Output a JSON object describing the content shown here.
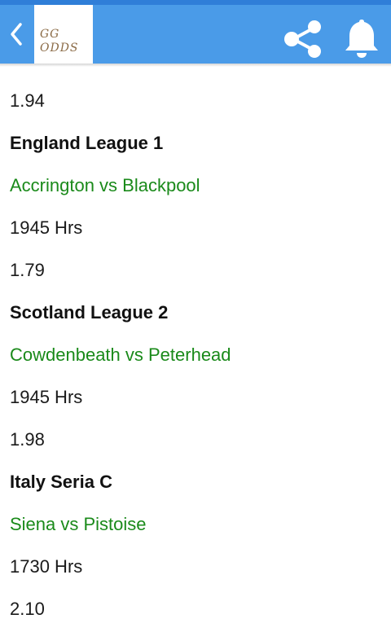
{
  "app_bar": {
    "logo_line1": "GG",
    "logo_line2": "ODDS",
    "icons": [
      "back-icon",
      "share-icon",
      "bell-icon"
    ],
    "colors": {
      "bar": "#4a9be8",
      "match_link": "#1a8a1a"
    }
  },
  "feed": [
    {
      "type": "odds",
      "text": "1.94"
    },
    {
      "type": "league",
      "text": "England League 1"
    },
    {
      "type": "match",
      "text": "Accrington vs Blackpool"
    },
    {
      "type": "time",
      "text": "1945 Hrs"
    },
    {
      "type": "odds",
      "text": "1.79"
    },
    {
      "type": "league",
      "text": "Scotland League 2"
    },
    {
      "type": "match",
      "text": "Cowdenbeath vs Peterhead"
    },
    {
      "type": "time",
      "text": "1945 Hrs"
    },
    {
      "type": "odds",
      "text": "1.98"
    },
    {
      "type": "league",
      "text": "Italy Seria C"
    },
    {
      "type": "match",
      "text": "Siena vs Pistoise"
    },
    {
      "type": "time",
      "text": "1730 Hrs"
    },
    {
      "type": "odds",
      "text": "2.10"
    }
  ]
}
